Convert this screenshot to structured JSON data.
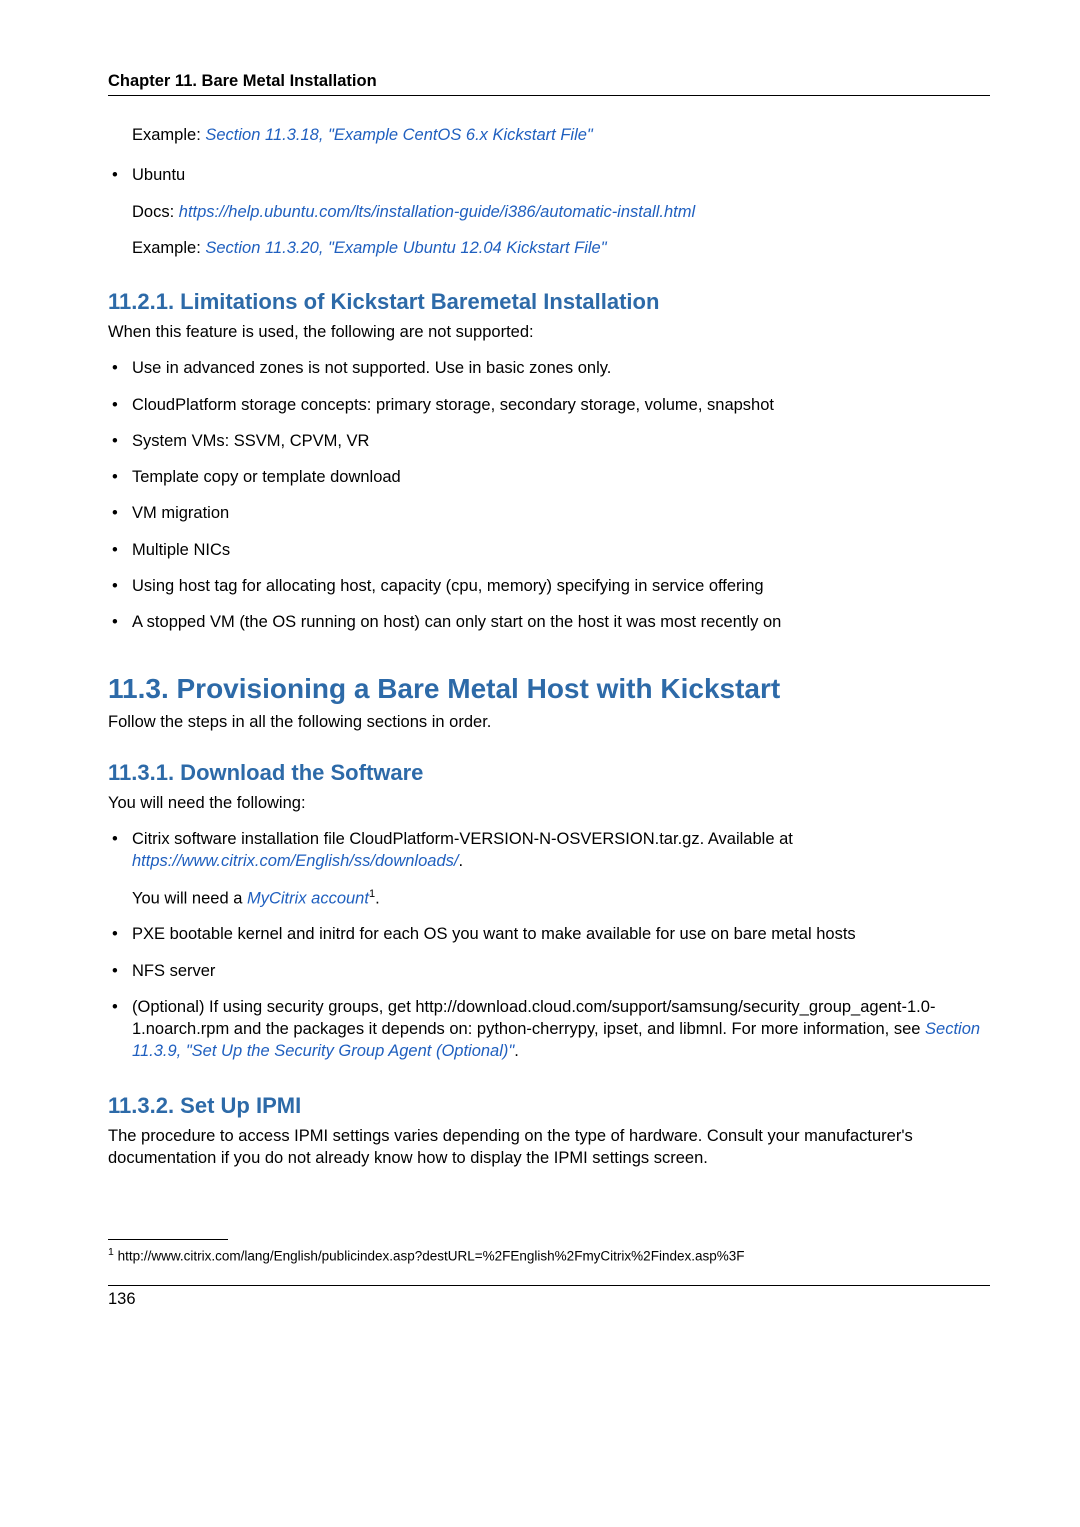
{
  "header": {
    "chapter": "Chapter 11. Bare Metal Installation"
  },
  "intro": {
    "example1_label": "Example: ",
    "example1_link": "Section 11.3.18, \"Example CentOS 6.x Kickstart File\"",
    "ubuntu": "Ubuntu",
    "docs_label": "Docs: ",
    "docs_link": "https://help.ubuntu.com/lts/installation-guide/i386/automatic-install.html",
    "example2_label": "Example: ",
    "example2_link": "Section 11.3.20, \"Example Ubuntu 12.04 Kickstart File\""
  },
  "s1121": {
    "title": "11.2.1. Limitations of Kickstart Baremetal Installation",
    "intro": "When this feature is used, the following are not supported:",
    "items": [
      "Use in advanced zones is not supported. Use in basic zones only.",
      "CloudPlatform storage concepts: primary storage, secondary storage, volume, snapshot",
      "System VMs: SSVM, CPVM, VR",
      "Template copy or template download",
      "VM migration",
      "Multiple NICs",
      "Using host tag for allocating host, capacity (cpu, memory) specifying in service offering",
      "A stopped VM (the OS running on host) can only start on the host it was most recently on"
    ]
  },
  "s113": {
    "title": "11.3. Provisioning a Bare Metal Host with Kickstart",
    "intro": "Follow the steps in all the following sections in order."
  },
  "s1131": {
    "title": "11.3.1. Download the Software",
    "intro": "You will need the following:",
    "b1a": "Citrix software installation file CloudPlatform-VERSION-N-OSVERSION.tar.gz. Available at ",
    "b1link": "https://www.citrix.com/English/ss/downloads/",
    "b1b": ".",
    "you_will_a": "You will need a ",
    "mycitrix": "MyCitrix account",
    "you_will_sup": "1",
    "you_will_b": ".",
    "b2": "PXE bootable kernel and initrd for each OS you want to make available for use on bare metal hosts",
    "b3": "NFS server",
    "b4a": "(Optional) If using security groups, get http://download.cloud.com/support/samsung/security_group_agent-1.0-1.noarch.rpm and the packages it depends on: python-cherrypy, ipset, and libmnl. For more information, see ",
    "b4link": "Section 11.3.9, \"Set Up the Security Group Agent (Optional)\"",
    "b4b": "."
  },
  "s1132": {
    "title": "11.3.2. Set Up IPMI",
    "intro": "The procedure to access IPMI settings varies depending on the type of hardware. Consult your manufacturer's documentation if you do not already know how to display the IPMI settings screen."
  },
  "footnote": {
    "num": "1",
    "text": " http://www.citrix.com/lang/English/publicindex.asp?destURL=%2FEnglish%2FmyCitrix%2Findex.asp%3F"
  },
  "pagenum": "136"
}
